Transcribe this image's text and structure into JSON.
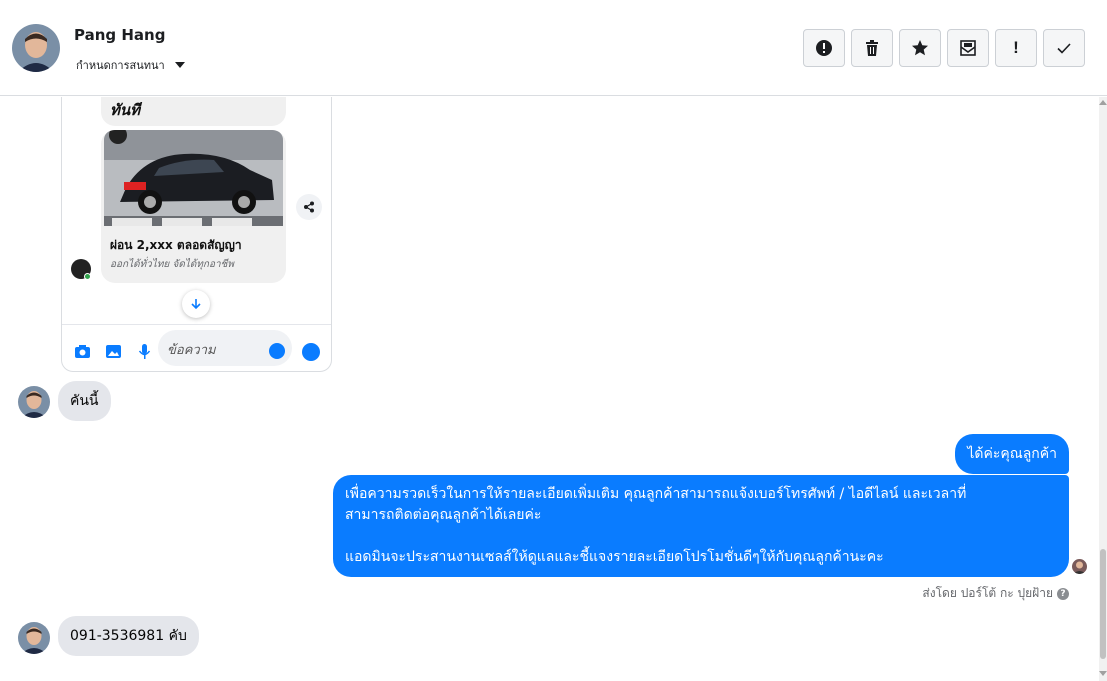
{
  "header": {
    "contact_name": "Pang Hang",
    "assign_label": "กำหนดการสนทนา",
    "toolbar": [
      {
        "name": "report-spam-button",
        "icon": "alert-circle-icon"
      },
      {
        "name": "delete-button",
        "icon": "trash-icon"
      },
      {
        "name": "star-button",
        "icon": "star-icon"
      },
      {
        "name": "mark-unread-button",
        "icon": "envelope-icon"
      },
      {
        "name": "mark-important-button",
        "icon": "exclamation-icon",
        "glyph": "!"
      },
      {
        "name": "mark-done-button",
        "icon": "checkmark-icon"
      }
    ]
  },
  "embedded_screenshot": {
    "top_text": "ทันที",
    "card_title": "ผ่อน 2,xxx ตลอดสัญญา",
    "card_subtitle": "ออกได้ทั่วไทย จัดได้ทุกอาชีพ",
    "input_placeholder": "ข้อความ"
  },
  "messages": {
    "incoming_1": "คันนี้",
    "outgoing_1": "ได้ค่ะคุณลูกค้า",
    "outgoing_2_line1": "เพื่อความรวดเร็วในการให้รายละเอียดเพิ่มเติม คุณลูกค้าสามารถแจ้งเบอร์โทรศัพท์ / ไอดีไลน์ และเวลาที่",
    "outgoing_2_line2": "สามารถติดต่อคุณลูกค้าได้เลยค่ะ",
    "outgoing_2_line3": "แอดมินจะประสานงานเซลส์ให้ดูแลและชี้แจงรายละเอียดโปรโมชั่นดีๆให้กับคุณลูกค้านะคะ",
    "sent_by": "ส่งโดย ปอร์โต้ กะ ปุยฝ้าย",
    "incoming_2": "091-3536981 คับ"
  },
  "colors": {
    "outgoing_bubble": "#0a7cff",
    "incoming_bubble": "#e4e6eb",
    "border": "#dadde1"
  }
}
